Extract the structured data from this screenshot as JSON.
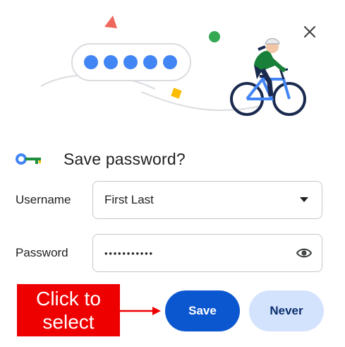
{
  "dialog": {
    "title": "Save password?",
    "close_icon": "close-icon",
    "key_icon": "key-icon"
  },
  "illustration": {
    "dots_count": 5,
    "dot_color": "#4285f4"
  },
  "fields": {
    "username": {
      "label": "Username",
      "value": "First Last",
      "trailing_icon": "dropdown-arrow-icon"
    },
    "password": {
      "label": "Password",
      "value": "•••••••••••",
      "trailing_icon": "eye-icon"
    }
  },
  "buttons": {
    "save": "Save",
    "never": "Never"
  },
  "callout": {
    "line1": "Click to",
    "line2": "select",
    "color": "#ee0000"
  },
  "colors": {
    "primary": "#0b57d0",
    "secondary_bg": "#d3e3fd",
    "secondary_text": "#0b2f6e"
  }
}
